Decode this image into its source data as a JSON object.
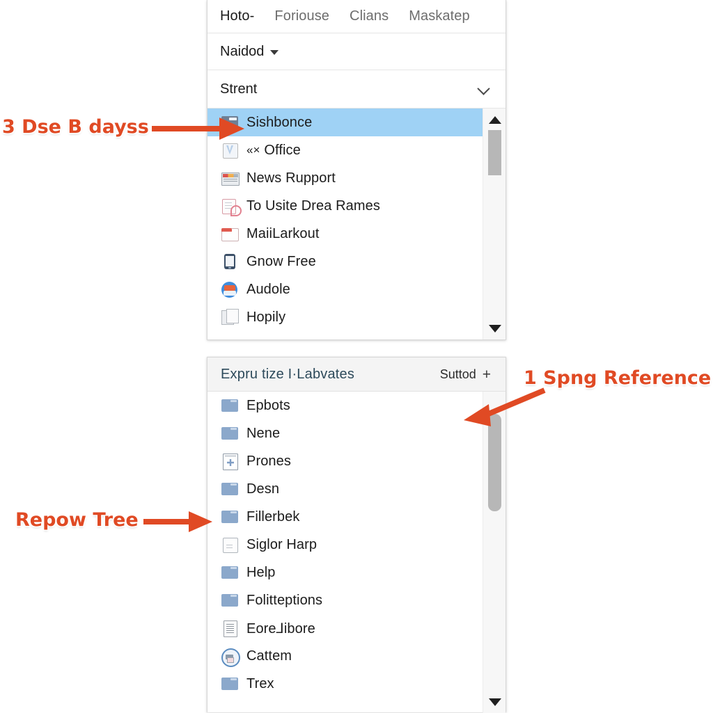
{
  "top_panel": {
    "tabs": [
      {
        "label": "Hoto-",
        "active": true
      },
      {
        "label": "Foriouse",
        "active": false
      },
      {
        "label": "Clians",
        "active": false
      },
      {
        "label": "Maskatep",
        "active": false
      }
    ],
    "dropdown": {
      "label": "Naidod",
      "icon": "caret-down-icon"
    },
    "section": {
      "label": "Strent",
      "icon": "chevron-down-icon"
    },
    "items": [
      {
        "label": "Sishbonce",
        "icon": "folder-icon",
        "selected": true,
        "prefix": ""
      },
      {
        "label": "Office",
        "icon": "checkbox-check-icon",
        "selected": false,
        "prefix": "«×"
      },
      {
        "label": "News Rupport",
        "icon": "news-icon",
        "selected": false,
        "prefix": ""
      },
      {
        "label": "To Usite Drea Rames",
        "icon": "note-tag-icon",
        "selected": false,
        "prefix": ""
      },
      {
        "label": "MaiiLarkout",
        "icon": "red-folder-icon",
        "selected": false,
        "prefix": ""
      },
      {
        "label": "Gnow Free",
        "icon": "phone-icon",
        "selected": false,
        "prefix": ""
      },
      {
        "label": "Audole",
        "icon": "audio-app-icon",
        "selected": false,
        "prefix": ""
      },
      {
        "label": "Hopily",
        "icon": "copy-pages-icon",
        "selected": false,
        "prefix": ""
      }
    ],
    "scrollbar": {
      "up_icon": "scroll-up-arrow-icon",
      "down_icon": "scroll-down-arrow-icon"
    }
  },
  "bottom_panel": {
    "header": {
      "title": "Expru tize I·Labvates",
      "action_label": "Suttod",
      "plus_icon": "plus-icon"
    },
    "items": [
      {
        "label": "Epbots",
        "icon": "folder-blue-icon"
      },
      {
        "label": "Nene",
        "icon": "folder-blue-icon"
      },
      {
        "label": "Prones",
        "icon": "plus-document-icon"
      },
      {
        "label": "Desn",
        "icon": "folder-blue-icon"
      },
      {
        "label": "Fillerbek",
        "icon": "folder-blue-icon"
      },
      {
        "label": "Siglor Harp",
        "icon": "blank-document-icon"
      },
      {
        "label": "Help",
        "icon": "folder-blue-icon"
      },
      {
        "label": "Folitteptions",
        "icon": "folder-blue-icon"
      },
      {
        "label": "Eore⅃ibore",
        "icon": "lines-document-icon"
      },
      {
        "label": "Cattem",
        "icon": "printer-icon"
      },
      {
        "label": "Trex",
        "icon": "folder-blue-icon"
      }
    ],
    "scrollbar": {
      "down_icon": "scroll-down-arrow-icon"
    }
  },
  "annotations": [
    {
      "text": "3 Dse B dayss",
      "color": "#e04a24"
    },
    {
      "text": "1 Spng Reference",
      "color": "#e04a24"
    },
    {
      "text": "Repow Tree",
      "color": "#e04a24"
    }
  ],
  "colors": {
    "accent_red": "#e04a24",
    "selection_blue": "#9fd2f5",
    "header_text": "#2d4a5b",
    "panel_bg": "#ffffff",
    "header_bg": "#f4f4f4"
  }
}
